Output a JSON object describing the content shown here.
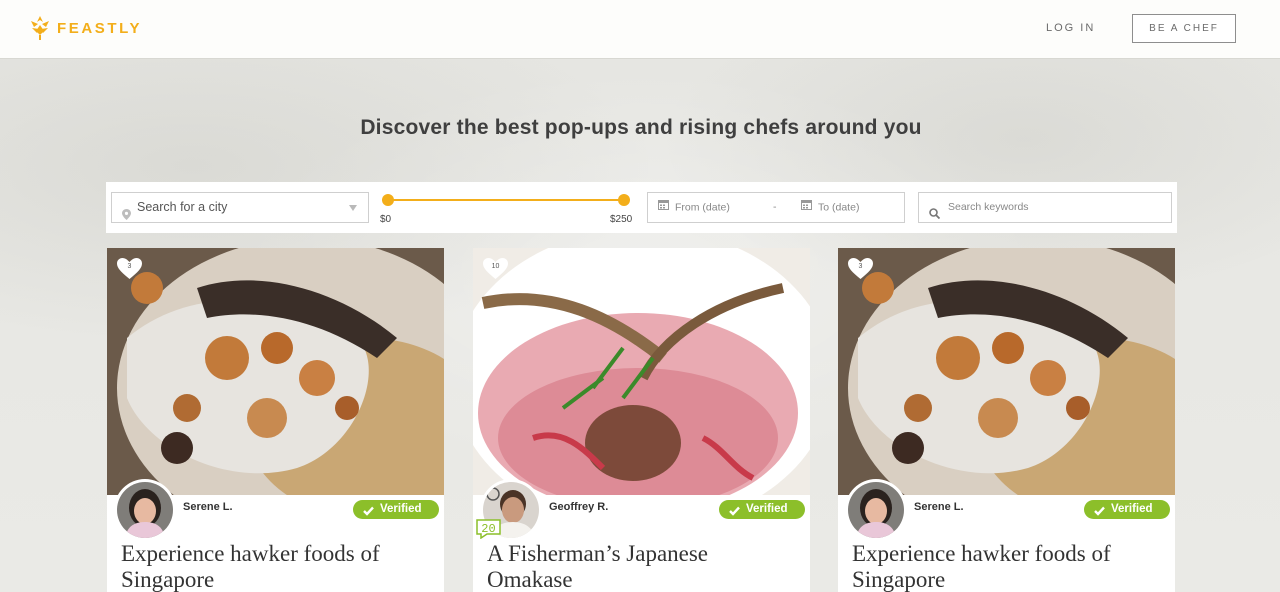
{
  "brand": {
    "name": "FEASTLY",
    "accent": "#f3ae1a"
  },
  "nav": {
    "login": "LOG IN",
    "be_chef": "BE A CHEF"
  },
  "headline": "Discover the best pop-ups and rising chefs around you",
  "filters": {
    "city_placeholder": "Search for a city",
    "price_min": "$0",
    "price_max": "$250",
    "date_from_placeholder": "From (date)",
    "date_separator": "-",
    "date_to_placeholder": "To (date)",
    "keywords_placeholder": "Search keywords"
  },
  "cards": [
    {
      "likes": "3",
      "chef": "Serene L.",
      "verified": "Verified",
      "title_line1": "Experience hawker foods of",
      "title_line2": "Singapore"
    },
    {
      "likes": "10",
      "chef": "Geoffrey R.",
      "verified": "Verified",
      "chef_badge": "20",
      "title_line1": "A Fisherman’s Japanese",
      "title_line2": "Omakase"
    },
    {
      "likes": "3",
      "chef": "Serene L.",
      "verified": "Verified",
      "title_line1": "Experience hawker foods of",
      "title_line2": "Singapore"
    }
  ],
  "colors": {
    "verified_green": "#8cbf2a",
    "text_dark": "#333333"
  }
}
